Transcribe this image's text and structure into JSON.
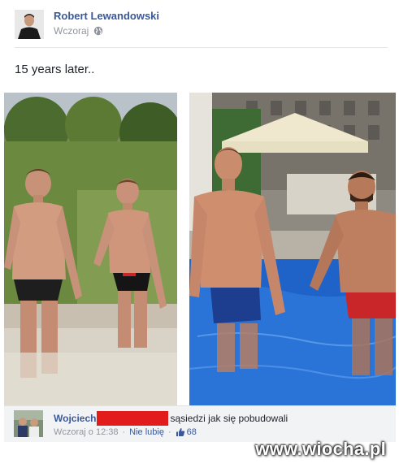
{
  "post": {
    "author": "Robert Lewandowski",
    "timestamp": "Wczoraj",
    "audience_icon": "globe-icon",
    "text": "15 years later..",
    "photos": [
      {
        "name": "childhood-pool-photo"
      },
      {
        "name": "adult-pool-photo"
      }
    ]
  },
  "comment": {
    "author": "Wojciech",
    "text": "sąsiedzi jak się pobudowali",
    "timestamp": "Wczoraj o 12:38",
    "unlike_label": "Nie lubię",
    "like_icon": "thumbs-up-icon",
    "like_count": "68",
    "redaction_color": "#e21b1b"
  },
  "watermark": "www.wiocha.pl",
  "colors": {
    "link": "#3b5998",
    "muted": "#90949c",
    "comment_bg": "#f2f3f5"
  }
}
